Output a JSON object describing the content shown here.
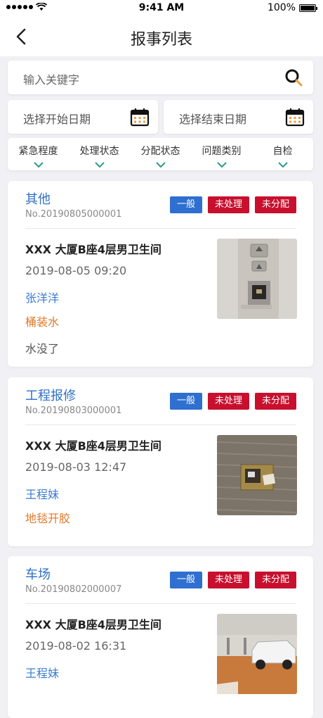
{
  "status_bar": {
    "time": "9:41 AM",
    "battery": "100%"
  },
  "nav": {
    "title": "报事列表"
  },
  "search": {
    "placeholder": "输入关键字"
  },
  "dates": {
    "start_placeholder": "选择开始日期",
    "end_placeholder": "选择结束日期"
  },
  "filters": [
    {
      "label": "紧急程度"
    },
    {
      "label": "处理状态"
    },
    {
      "label": "分配状态"
    },
    {
      "label": "问题类别"
    },
    {
      "label": "自检"
    }
  ],
  "cards": [
    {
      "category": "其他",
      "number": "No.20190805000001",
      "badges": [
        "一般",
        "未处理",
        "未分配"
      ],
      "location": "XXX 大厦B座4层男卫生间",
      "datetime": "2019-08-05 09:20",
      "person": "张洋洋",
      "type": "桶装水",
      "description": "水没了",
      "photo": "elevator-panel-photo"
    },
    {
      "category": "工程报修",
      "number": "No.20190803000001",
      "badges": [
        "一般",
        "未处理",
        "未分配"
      ],
      "location": "XXX 大厦B座4层男卫生间",
      "datetime": "2019-08-03 12:47",
      "person": "王程妹",
      "type": "地毯开胶",
      "photo": "carpet-floor-box-photo"
    },
    {
      "category": "车场",
      "number": "No.20190802000007",
      "badges": [
        "一般",
        "未处理",
        "未分配"
      ],
      "location": "XXX 大厦B座4层男卫生间",
      "datetime": "2019-08-02 16:31",
      "person": "王程妹",
      "photo": "parking-garage-photo"
    }
  ],
  "colors": {
    "accent_blue": "#2d6fc4",
    "badge_blue": "#2e6fd0",
    "badge_red": "#c8102e",
    "type_orange": "#e07a2c",
    "page_bg": "#f1f1f5"
  }
}
